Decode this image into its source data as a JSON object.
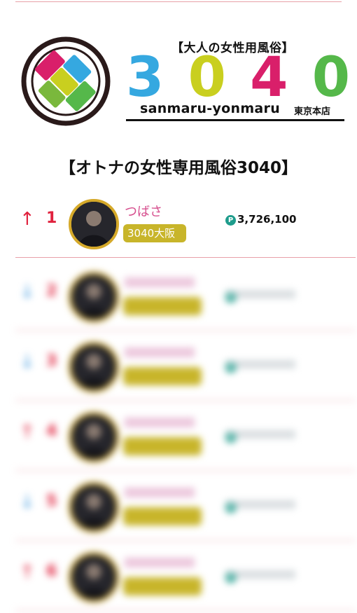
{
  "logo": {
    "tagline": "【大人の女性用風俗】",
    "digits": [
      "3",
      "0",
      "4",
      "0"
    ],
    "digit_colors": [
      "#35a8e0",
      "#c9cf1f",
      "#d91f6a",
      "#55b84a"
    ],
    "romaji": "sanmaru-yonmaru",
    "branch": "東京本店"
  },
  "heading": "【オトナの女性専用風俗3040】",
  "point_icon_label": "P",
  "ranking": [
    {
      "rank": "1",
      "trend": "up",
      "arrow": "↑",
      "name": "つばさ",
      "shop": "3040大阪",
      "points": "3,726,100",
      "blurred": false
    },
    {
      "rank": "2",
      "trend": "down",
      "arrow": "↓",
      "name": "",
      "shop": "",
      "points": "",
      "blurred": true
    },
    {
      "rank": "3",
      "trend": "down",
      "arrow": "↓",
      "name": "",
      "shop": "",
      "points": "",
      "blurred": true
    },
    {
      "rank": "4",
      "trend": "up",
      "arrow": "↑",
      "name": "",
      "shop": "",
      "points": "",
      "blurred": true
    },
    {
      "rank": "5",
      "trend": "down",
      "arrow": "↓",
      "name": "",
      "shop": "",
      "points": "",
      "blurred": true
    },
    {
      "rank": "6",
      "trend": "up",
      "arrow": "↑",
      "name": "",
      "shop": "",
      "points": "",
      "blurred": true
    }
  ],
  "colors": {
    "up_arrow": "#e0223e",
    "down_arrow": "#4a9fe0",
    "rank_number": "#e0223e",
    "name": "#d64f8e",
    "badge": "#c8b52a",
    "point_icon": "#1e9c8c",
    "divider": "#e8a0a8"
  }
}
